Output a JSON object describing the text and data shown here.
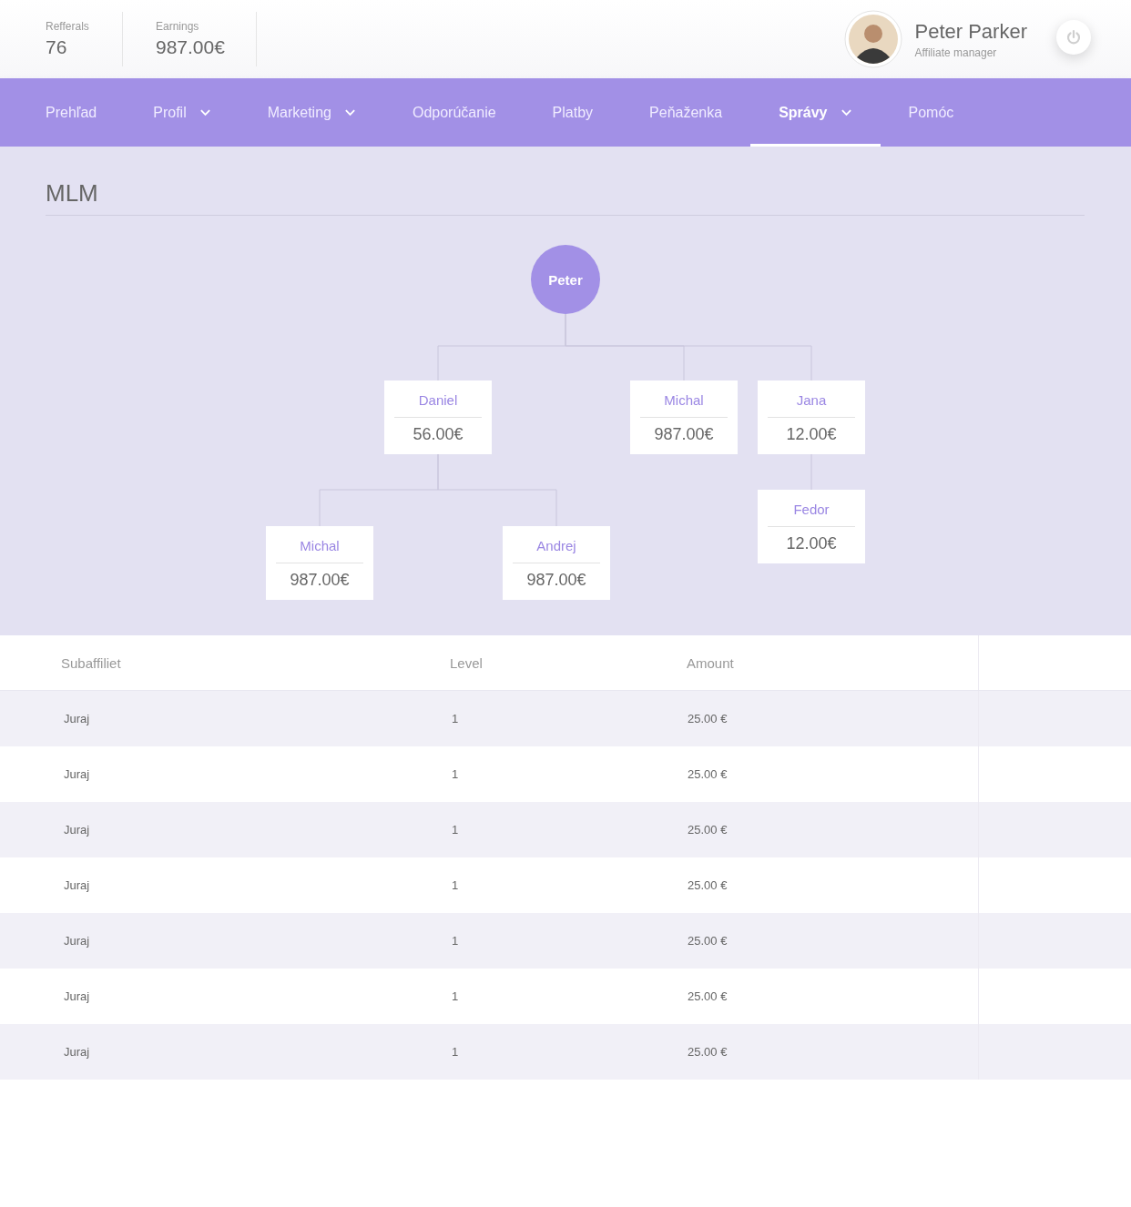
{
  "stats": [
    {
      "label": "Refferals",
      "value": "76"
    },
    {
      "label": "Earnings",
      "value": "987.00€"
    }
  ],
  "user": {
    "name": "Peter Parker",
    "role": "Affiliate manager"
  },
  "nav": [
    {
      "label": "Prehľad",
      "dropdown": false,
      "selected": false
    },
    {
      "label": "Profil",
      "dropdown": true,
      "selected": false
    },
    {
      "label": "Marketing",
      "dropdown": true,
      "selected": false
    },
    {
      "label": "Odporúčanie",
      "dropdown": false,
      "selected": false
    },
    {
      "label": "Platby",
      "dropdown": false,
      "selected": false
    },
    {
      "label": "Peňaženka",
      "dropdown": false,
      "selected": false
    },
    {
      "label": "Správy",
      "dropdown": true,
      "selected": true
    },
    {
      "label": "Pomóc",
      "dropdown": false,
      "selected": false
    }
  ],
  "page_title": "MLM",
  "tree": {
    "name": "Peter",
    "children": [
      {
        "name": "Daniel",
        "amount": "56.00€",
        "children": [
          {
            "name": "Michal",
            "amount": "987.00€"
          },
          {
            "name": "Andrej",
            "amount": "987.00€"
          }
        ]
      },
      {
        "name": "Michal",
        "amount": "987.00€"
      },
      {
        "name": "Jana",
        "amount": "12.00€",
        "children": [
          {
            "name": "Fedor",
            "amount": "12.00€"
          }
        ]
      }
    ]
  },
  "table": {
    "columns": [
      "Subaffiliet",
      "Level",
      "Amount"
    ],
    "rows": [
      [
        "Juraj",
        "1",
        "25.00 €"
      ],
      [
        "Juraj",
        "1",
        "25.00 €"
      ],
      [
        "Juraj",
        "1",
        "25.00 €"
      ],
      [
        "Juraj",
        "1",
        "25.00 €"
      ],
      [
        "Juraj",
        "1",
        "25.00 €"
      ],
      [
        "Juraj",
        "1",
        "25.00 €"
      ],
      [
        "Juraj",
        "1",
        "25.00 €"
      ]
    ]
  }
}
